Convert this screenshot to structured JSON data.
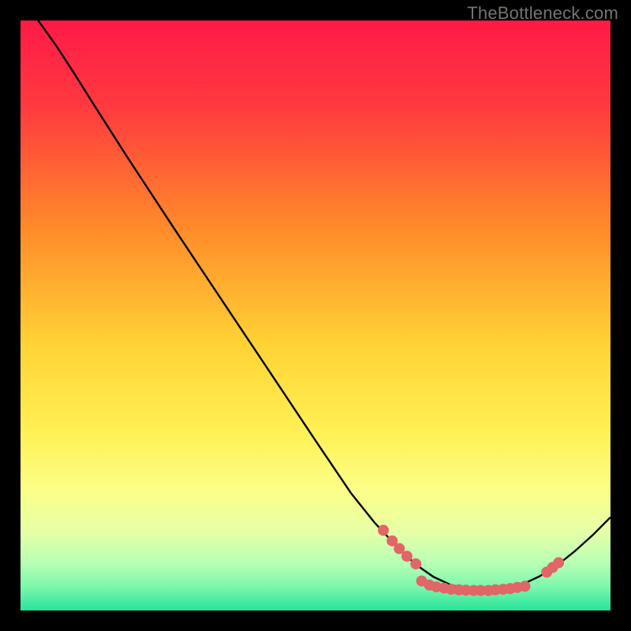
{
  "watermark": "TheBottleneck.com",
  "chart_data": {
    "type": "line",
    "title": "",
    "xlabel": "",
    "ylabel": "",
    "xlim": [
      0,
      100
    ],
    "ylim": [
      0,
      100
    ],
    "gradient_stops": [
      {
        "offset": 0.0,
        "color": "#ff1a47"
      },
      {
        "offset": 0.15,
        "color": "#ff3b3f"
      },
      {
        "offset": 0.35,
        "color": "#ff8a2a"
      },
      {
        "offset": 0.55,
        "color": "#ffd335"
      },
      {
        "offset": 0.7,
        "color": "#fff156"
      },
      {
        "offset": 0.8,
        "color": "#fbff8a"
      },
      {
        "offset": 0.87,
        "color": "#e4ffa8"
      },
      {
        "offset": 0.92,
        "color": "#b6ffb4"
      },
      {
        "offset": 0.96,
        "color": "#7cf7ac"
      },
      {
        "offset": 1.0,
        "color": "#26e29a"
      }
    ],
    "series": [
      {
        "name": "curve",
        "points": [
          {
            "x": 3.0,
            "y": 100.0
          },
          {
            "x": 6.0,
            "y": 95.8
          },
          {
            "x": 9.0,
            "y": 91.2
          },
          {
            "x": 12.0,
            "y": 86.4
          },
          {
            "x": 18.0,
            "y": 77.0
          },
          {
            "x": 26.0,
            "y": 64.8
          },
          {
            "x": 34.0,
            "y": 52.8
          },
          {
            "x": 42.0,
            "y": 40.8
          },
          {
            "x": 50.0,
            "y": 28.8
          },
          {
            "x": 56.0,
            "y": 19.9
          },
          {
            "x": 60.0,
            "y": 14.9
          },
          {
            "x": 64.0,
            "y": 10.6
          },
          {
            "x": 67.0,
            "y": 7.8
          },
          {
            "x": 70.0,
            "y": 5.7
          },
          {
            "x": 73.0,
            "y": 4.3
          },
          {
            "x": 76.0,
            "y": 3.6
          },
          {
            "x": 79.0,
            "y": 3.4
          },
          {
            "x": 82.0,
            "y": 3.6
          },
          {
            "x": 85.0,
            "y": 4.4
          },
          {
            "x": 88.0,
            "y": 5.8
          },
          {
            "x": 91.0,
            "y": 7.7
          },
          {
            "x": 94.0,
            "y": 10.1
          },
          {
            "x": 97.0,
            "y": 12.8
          },
          {
            "x": 100.0,
            "y": 15.8
          }
        ]
      }
    ],
    "markers": [
      {
        "x": 61.5,
        "y": 13.6
      },
      {
        "x": 63.0,
        "y": 11.8
      },
      {
        "x": 64.2,
        "y": 10.5
      },
      {
        "x": 65.5,
        "y": 9.2
      },
      {
        "x": 67.0,
        "y": 7.9
      },
      {
        "x": 68.0,
        "y": 5.0
      },
      {
        "x": 69.3,
        "y": 4.3
      },
      {
        "x": 70.5,
        "y": 4.0
      },
      {
        "x": 71.8,
        "y": 3.8
      },
      {
        "x": 73.0,
        "y": 3.6
      },
      {
        "x": 74.3,
        "y": 3.5
      },
      {
        "x": 75.5,
        "y": 3.45
      },
      {
        "x": 76.8,
        "y": 3.4
      },
      {
        "x": 78.0,
        "y": 3.4
      },
      {
        "x": 79.3,
        "y": 3.4
      },
      {
        "x": 80.5,
        "y": 3.5
      },
      {
        "x": 81.8,
        "y": 3.6
      },
      {
        "x": 83.0,
        "y": 3.7
      },
      {
        "x": 84.2,
        "y": 3.9
      },
      {
        "x": 85.5,
        "y": 4.1
      },
      {
        "x": 89.2,
        "y": 6.5
      },
      {
        "x": 90.2,
        "y": 7.3
      },
      {
        "x": 91.2,
        "y": 8.1
      }
    ],
    "marker_style": {
      "fill": "#e16666",
      "r": 7
    }
  }
}
